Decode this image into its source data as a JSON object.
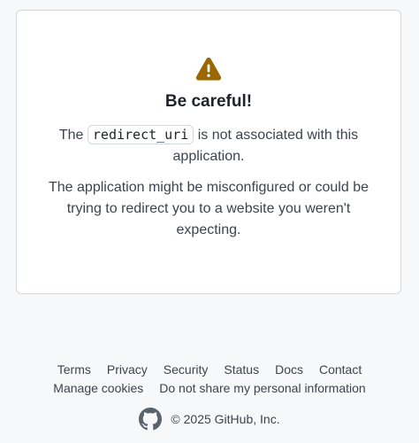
{
  "card": {
    "icon": "alert-icon",
    "heading": "Be careful!",
    "message1_before": "The",
    "message1_code": "redirect_uri",
    "message1_after": "is not associated with this application.",
    "message2": "The application might be misconfigured or could be trying to redirect you to a website you weren't expecting."
  },
  "footer": {
    "links_row1": [
      "Terms",
      "Privacy",
      "Security",
      "Status",
      "Docs",
      "Contact"
    ],
    "links_row2": [
      "Manage cookies",
      "Do not share my personal information"
    ],
    "logo_icon": "github-mark-icon",
    "copyright": "© 2025 GitHub, Inc."
  },
  "colors": {
    "page_background": "#f6f8fa",
    "card_background": "#ffffff",
    "border": "#d1d9e0",
    "alert_icon": "#9a6700",
    "text_primary": "#1f2328",
    "text_secondary": "#3d444d"
  }
}
